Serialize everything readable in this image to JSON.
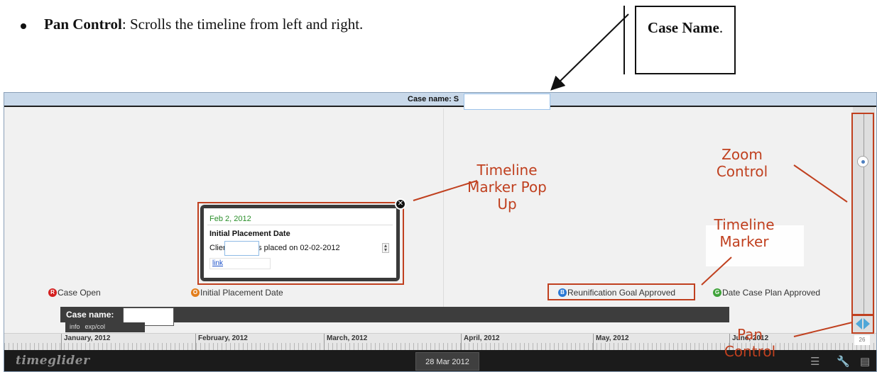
{
  "doc": {
    "bullet_title": "Pan Control",
    "bullet_text": ": Scrolls the timeline from left and right.",
    "callout_bold": "Case Name",
    "callout_suffix": "."
  },
  "timeline": {
    "title_prefix": "Case name: S",
    "popup": {
      "date": "Feb 2, 2012",
      "title": "Initial Placement Date",
      "desc_start": "Clien",
      "desc_end": "s placed on 02-02-2012",
      "link": "link",
      "close_glyph": "✕"
    },
    "markers": [
      {
        "letter": "R",
        "color": "#d42020",
        "label": "Case Open"
      },
      {
        "letter": "O",
        "color": "#e27d1b",
        "label": "Initial Placement Date"
      },
      {
        "letter": "B",
        "color": "#2a78d4",
        "label": "Reunification Goal Approved"
      },
      {
        "letter": "G",
        "color": "#3fa33a",
        "label": "Date Case Plan Approved"
      }
    ],
    "band": {
      "label": "Case name:",
      "tabs": [
        "info",
        "exp/col"
      ]
    },
    "months": [
      "January, 2012",
      "February, 2012",
      "March, 2012",
      "April, 2012",
      "May, 2012",
      "June, 2012"
    ],
    "footer": {
      "logo": "timeglider",
      "date": "28 Mar 2012",
      "icons": [
        "list-icon",
        "wrench-icon",
        "film-icon"
      ]
    },
    "zoom_level": "26"
  },
  "annotations": {
    "popup": "Timeline Marker Pop Up",
    "zoom": "Zoom Control",
    "marker": "Timeline Marker",
    "pan": "Pan Control"
  },
  "colors": {
    "annotation": "#c0401f",
    "title_bar": "#c9d9ea",
    "pan_arrow": "#4fa7d8"
  }
}
